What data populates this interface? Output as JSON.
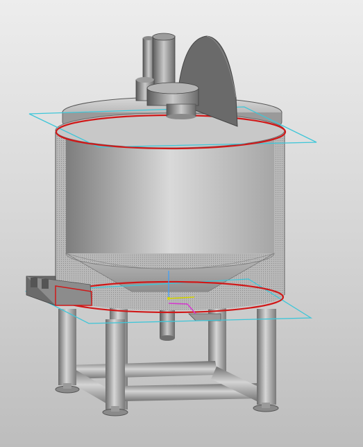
{
  "colors": {
    "background_top": "#ededed",
    "background_bottom": "#bdbdbd",
    "sketch_plane": "#3ec6d8",
    "selection_edge": "#d01818",
    "axis_x": "#d63ad0",
    "axis_y": "#d4d400",
    "axis_z": "#39a0ff",
    "metal_dark": "#5e5e5e",
    "metal_light": "#cfcfcf"
  },
  "model": {
    "parts": [
      "tank-body",
      "tank-lid",
      "agitator-drive",
      "agitator-disc",
      "conical-bottom",
      "outlet-pipe",
      "side-bracket",
      "support-legs",
      "leg-braces",
      "leveling-feet"
    ],
    "selected_edges": 2,
    "sketch_planes": 2
  }
}
